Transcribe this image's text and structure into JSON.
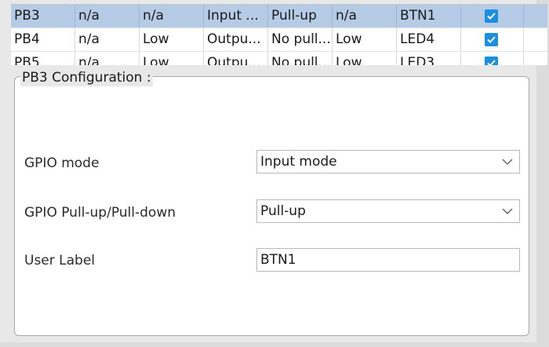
{
  "table": {
    "rows": [
      {
        "pin": "PB3",
        "output_level": "n/a",
        "gpio_state": "n/a",
        "mode": "Input ...",
        "pull": "Pull-up",
        "speed": "n/a",
        "user_label": "BTN1",
        "checked": true,
        "selected": true
      },
      {
        "pin": "PB4",
        "output_level": "n/a",
        "gpio_state": "Low",
        "mode": "Outpu...",
        "pull": "No pull...",
        "speed": "Low",
        "user_label": "LED4",
        "checked": true,
        "selected": false
      },
      {
        "pin": "PB5",
        "output_level": "n/a",
        "gpio_state": "Low",
        "mode": "Outpu...",
        "pull": "No pull...",
        "speed": "Low",
        "user_label": "LED3",
        "checked": true,
        "selected": false
      }
    ]
  },
  "config": {
    "title": "PB3 Configuration :",
    "gpio_mode_label": "GPIO mode",
    "gpio_mode_value": "Input mode",
    "pull_label": "GPIO Pull-up/Pull-down",
    "pull_value": "Pull-up",
    "user_label_label": "User Label",
    "user_label_value": "BTN1"
  },
  "icons": {
    "checkbox": "checkmark-icon",
    "dropdown": "chevron-down-icon"
  },
  "colors": {
    "selected_row": "#b5cbe6",
    "checkbox": "#1a8fe0"
  }
}
